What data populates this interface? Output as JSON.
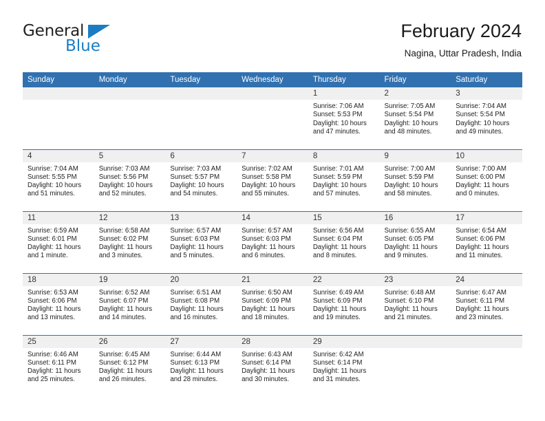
{
  "brand": {
    "name_top": "General",
    "name_bottom": "Blue",
    "triangle_color": "#1a7dc4",
    "text_color": "#231f20"
  },
  "header": {
    "title": "February 2024",
    "subtitle": "Nagina, Uttar Pradesh, India"
  },
  "theme": {
    "header_blue": "#3171b0",
    "day_number_band": "#f0f0f0",
    "cell_background": "#ffffff",
    "text": "#222222"
  },
  "calendar": {
    "weekday_headers": [
      "Sunday",
      "Monday",
      "Tuesday",
      "Wednesday",
      "Thursday",
      "Friday",
      "Saturday"
    ],
    "weeks": [
      [
        {
          "day": "",
          "sunrise": "",
          "sunset": "",
          "daylight_line1": "",
          "daylight_line2": ""
        },
        {
          "day": "",
          "sunrise": "",
          "sunset": "",
          "daylight_line1": "",
          "daylight_line2": ""
        },
        {
          "day": "",
          "sunrise": "",
          "sunset": "",
          "daylight_line1": "",
          "daylight_line2": ""
        },
        {
          "day": "",
          "sunrise": "",
          "sunset": "",
          "daylight_line1": "",
          "daylight_line2": ""
        },
        {
          "day": "1",
          "sunrise": "Sunrise: 7:06 AM",
          "sunset": "Sunset: 5:53 PM",
          "daylight_line1": "Daylight: 10 hours",
          "daylight_line2": "and 47 minutes."
        },
        {
          "day": "2",
          "sunrise": "Sunrise: 7:05 AM",
          "sunset": "Sunset: 5:54 PM",
          "daylight_line1": "Daylight: 10 hours",
          "daylight_line2": "and 48 minutes."
        },
        {
          "day": "3",
          "sunrise": "Sunrise: 7:04 AM",
          "sunset": "Sunset: 5:54 PM",
          "daylight_line1": "Daylight: 10 hours",
          "daylight_line2": "and 49 minutes."
        }
      ],
      [
        {
          "day": "4",
          "sunrise": "Sunrise: 7:04 AM",
          "sunset": "Sunset: 5:55 PM",
          "daylight_line1": "Daylight: 10 hours",
          "daylight_line2": "and 51 minutes."
        },
        {
          "day": "5",
          "sunrise": "Sunrise: 7:03 AM",
          "sunset": "Sunset: 5:56 PM",
          "daylight_line1": "Daylight: 10 hours",
          "daylight_line2": "and 52 minutes."
        },
        {
          "day": "6",
          "sunrise": "Sunrise: 7:03 AM",
          "sunset": "Sunset: 5:57 PM",
          "daylight_line1": "Daylight: 10 hours",
          "daylight_line2": "and 54 minutes."
        },
        {
          "day": "7",
          "sunrise": "Sunrise: 7:02 AM",
          "sunset": "Sunset: 5:58 PM",
          "daylight_line1": "Daylight: 10 hours",
          "daylight_line2": "and 55 minutes."
        },
        {
          "day": "8",
          "sunrise": "Sunrise: 7:01 AM",
          "sunset": "Sunset: 5:59 PM",
          "daylight_line1": "Daylight: 10 hours",
          "daylight_line2": "and 57 minutes."
        },
        {
          "day": "9",
          "sunrise": "Sunrise: 7:00 AM",
          "sunset": "Sunset: 5:59 PM",
          "daylight_line1": "Daylight: 10 hours",
          "daylight_line2": "and 58 minutes."
        },
        {
          "day": "10",
          "sunrise": "Sunrise: 7:00 AM",
          "sunset": "Sunset: 6:00 PM",
          "daylight_line1": "Daylight: 11 hours",
          "daylight_line2": "and 0 minutes."
        }
      ],
      [
        {
          "day": "11",
          "sunrise": "Sunrise: 6:59 AM",
          "sunset": "Sunset: 6:01 PM",
          "daylight_line1": "Daylight: 11 hours",
          "daylight_line2": "and 1 minute."
        },
        {
          "day": "12",
          "sunrise": "Sunrise: 6:58 AM",
          "sunset": "Sunset: 6:02 PM",
          "daylight_line1": "Daylight: 11 hours",
          "daylight_line2": "and 3 minutes."
        },
        {
          "day": "13",
          "sunrise": "Sunrise: 6:57 AM",
          "sunset": "Sunset: 6:03 PM",
          "daylight_line1": "Daylight: 11 hours",
          "daylight_line2": "and 5 minutes."
        },
        {
          "day": "14",
          "sunrise": "Sunrise: 6:57 AM",
          "sunset": "Sunset: 6:03 PM",
          "daylight_line1": "Daylight: 11 hours",
          "daylight_line2": "and 6 minutes."
        },
        {
          "day": "15",
          "sunrise": "Sunrise: 6:56 AM",
          "sunset": "Sunset: 6:04 PM",
          "daylight_line1": "Daylight: 11 hours",
          "daylight_line2": "and 8 minutes."
        },
        {
          "day": "16",
          "sunrise": "Sunrise: 6:55 AM",
          "sunset": "Sunset: 6:05 PM",
          "daylight_line1": "Daylight: 11 hours",
          "daylight_line2": "and 9 minutes."
        },
        {
          "day": "17",
          "sunrise": "Sunrise: 6:54 AM",
          "sunset": "Sunset: 6:06 PM",
          "daylight_line1": "Daylight: 11 hours",
          "daylight_line2": "and 11 minutes."
        }
      ],
      [
        {
          "day": "18",
          "sunrise": "Sunrise: 6:53 AM",
          "sunset": "Sunset: 6:06 PM",
          "daylight_line1": "Daylight: 11 hours",
          "daylight_line2": "and 13 minutes."
        },
        {
          "day": "19",
          "sunrise": "Sunrise: 6:52 AM",
          "sunset": "Sunset: 6:07 PM",
          "daylight_line1": "Daylight: 11 hours",
          "daylight_line2": "and 14 minutes."
        },
        {
          "day": "20",
          "sunrise": "Sunrise: 6:51 AM",
          "sunset": "Sunset: 6:08 PM",
          "daylight_line1": "Daylight: 11 hours",
          "daylight_line2": "and 16 minutes."
        },
        {
          "day": "21",
          "sunrise": "Sunrise: 6:50 AM",
          "sunset": "Sunset: 6:09 PM",
          "daylight_line1": "Daylight: 11 hours",
          "daylight_line2": "and 18 minutes."
        },
        {
          "day": "22",
          "sunrise": "Sunrise: 6:49 AM",
          "sunset": "Sunset: 6:09 PM",
          "daylight_line1": "Daylight: 11 hours",
          "daylight_line2": "and 19 minutes."
        },
        {
          "day": "23",
          "sunrise": "Sunrise: 6:48 AM",
          "sunset": "Sunset: 6:10 PM",
          "daylight_line1": "Daylight: 11 hours",
          "daylight_line2": "and 21 minutes."
        },
        {
          "day": "24",
          "sunrise": "Sunrise: 6:47 AM",
          "sunset": "Sunset: 6:11 PM",
          "daylight_line1": "Daylight: 11 hours",
          "daylight_line2": "and 23 minutes."
        }
      ],
      [
        {
          "day": "25",
          "sunrise": "Sunrise: 6:46 AM",
          "sunset": "Sunset: 6:11 PM",
          "daylight_line1": "Daylight: 11 hours",
          "daylight_line2": "and 25 minutes."
        },
        {
          "day": "26",
          "sunrise": "Sunrise: 6:45 AM",
          "sunset": "Sunset: 6:12 PM",
          "daylight_line1": "Daylight: 11 hours",
          "daylight_line2": "and 26 minutes."
        },
        {
          "day": "27",
          "sunrise": "Sunrise: 6:44 AM",
          "sunset": "Sunset: 6:13 PM",
          "daylight_line1": "Daylight: 11 hours",
          "daylight_line2": "and 28 minutes."
        },
        {
          "day": "28",
          "sunrise": "Sunrise: 6:43 AM",
          "sunset": "Sunset: 6:14 PM",
          "daylight_line1": "Daylight: 11 hours",
          "daylight_line2": "and 30 minutes."
        },
        {
          "day": "29",
          "sunrise": "Sunrise: 6:42 AM",
          "sunset": "Sunset: 6:14 PM",
          "daylight_line1": "Daylight: 11 hours",
          "daylight_line2": "and 31 minutes."
        },
        {
          "day": "",
          "sunrise": "",
          "sunset": "",
          "daylight_line1": "",
          "daylight_line2": ""
        },
        {
          "day": "",
          "sunrise": "",
          "sunset": "",
          "daylight_line1": "",
          "daylight_line2": ""
        }
      ]
    ]
  }
}
